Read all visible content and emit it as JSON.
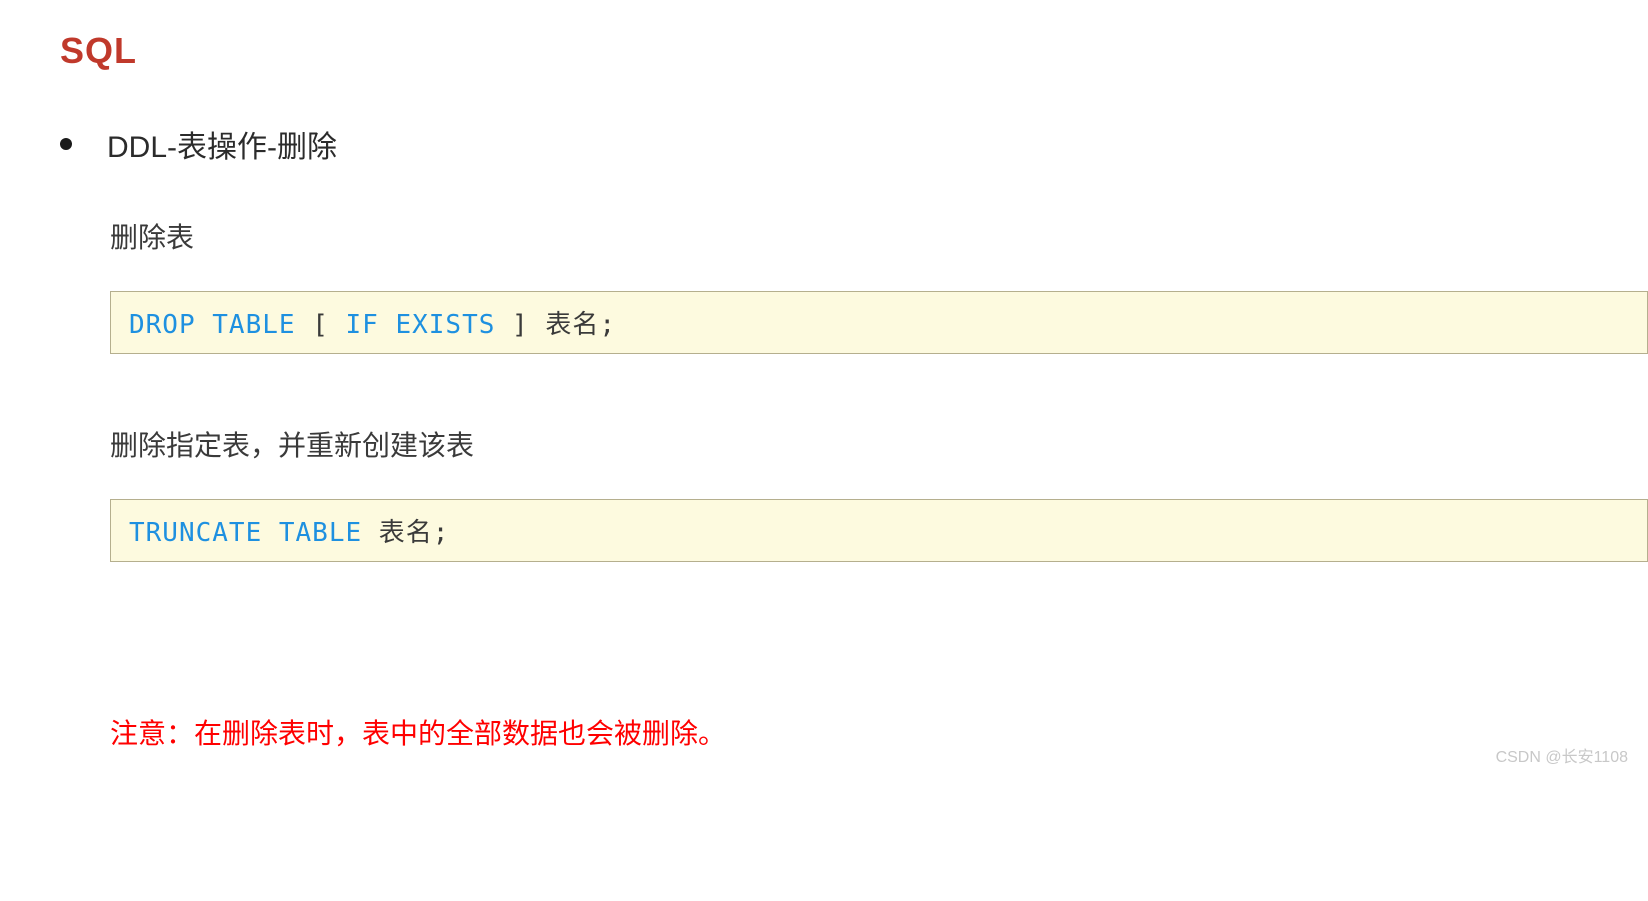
{
  "title": "SQL",
  "bullet": {
    "heading": "DDL-表操作-删除"
  },
  "section1": {
    "subtitle": "删除表",
    "code": {
      "kw1": "DROP  TABLE",
      "bracket_open": " [ ",
      "kw2": "IF  EXISTS",
      "bracket_close": " ] ",
      "tail": "表名;"
    }
  },
  "section2": {
    "subtitle": "删除指定表，并重新创建该表",
    "code": {
      "kw1": "TRUNCATE  TABLE",
      "tail": " 表名;"
    }
  },
  "note": "注意：在删除表时，表中的全部数据也会被删除。",
  "watermark": "CSDN @长安1108"
}
